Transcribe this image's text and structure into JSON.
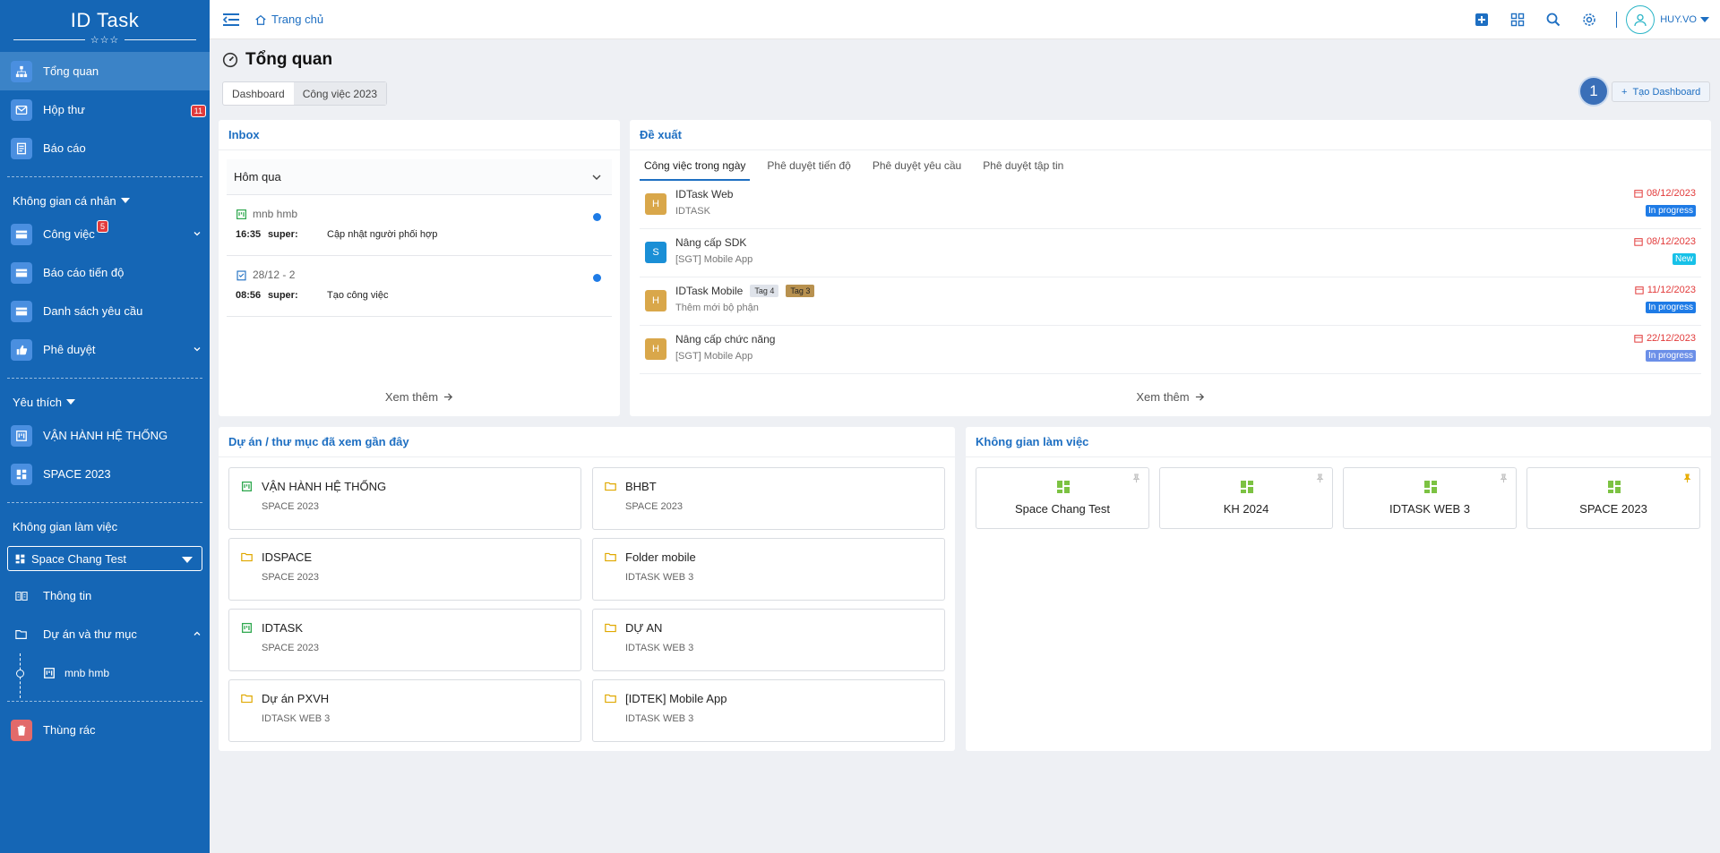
{
  "app": {
    "name": "ID Task",
    "stars": "☆☆☆"
  },
  "sidebar": {
    "main_items": [
      {
        "label": "Tổng quan"
      },
      {
        "label": "Hộp thư",
        "badge": "11"
      },
      {
        "label": "Báo cáo"
      }
    ],
    "personal_section": "Không gian cá nhân",
    "personal_items": [
      {
        "label": "Công việc",
        "badge": "5"
      },
      {
        "label": "Báo cáo tiến độ"
      },
      {
        "label": "Danh sách yêu cầu"
      },
      {
        "label": "Phê duyệt"
      }
    ],
    "favorites_section": "Yêu thích",
    "favorite_items": [
      {
        "label": "VẬN HÀNH HỆ THỐNG"
      },
      {
        "label": "SPACE 2023"
      }
    ],
    "workspace_section": "Không gian làm việc",
    "workspace_selected": "Space Chang Test",
    "workspace_items": [
      {
        "label": "Thông tin"
      },
      {
        "label": "Dự án và thư mục"
      }
    ],
    "tree_item": "mnb hmb",
    "trash": "Thùng rác"
  },
  "topbar": {
    "home": "Trang chủ",
    "username": "HUY.VO"
  },
  "page": {
    "title": "Tổng quan",
    "tabs": [
      "Dashboard",
      "Công việc 2023"
    ],
    "step": "1",
    "create_dashboard": "Tạo Dashboard"
  },
  "inbox": {
    "title": "Inbox",
    "group": "Hôm qua",
    "items": [
      {
        "source": "mnb hmb",
        "time": "16:35",
        "who": "super:",
        "action": "Cập nhật người phối hợp"
      },
      {
        "source": "28/12 - 2",
        "time": "08:56",
        "who": "super:",
        "action": "Tạo công việc"
      }
    ],
    "see_more": "Xem thêm"
  },
  "suggestions": {
    "title": "Đề xuất",
    "tabs": [
      "Công việc trong ngày",
      "Phê duyệt tiến độ",
      "Phê duyệt yêu cầu",
      "Phê duyệt tập tin"
    ],
    "items": [
      {
        "avatar": "H",
        "name": "IDTask Web",
        "sub": "IDTASK",
        "date": "08/12/2023",
        "status": "In progress"
      },
      {
        "avatar": "S",
        "name": "Nâng cấp SDK",
        "sub": "[SGT] Mobile App",
        "date": "08/12/2023",
        "status": "New"
      },
      {
        "avatar": "H",
        "name": "IDTask Mobile",
        "sub": "Thêm mới bộ phận",
        "date": "11/12/2023",
        "status": "In progress",
        "tags": [
          "Tag 4",
          "Tag 3"
        ]
      },
      {
        "avatar": "H",
        "name": "Nâng cấp chức năng",
        "sub": "[SGT] Mobile App",
        "date": "22/12/2023",
        "status": "In progress"
      }
    ],
    "see_more": "Xem thêm"
  },
  "recent": {
    "title": "Dự án / thư mục đã xem gần đây",
    "items": [
      {
        "name": "VẬN HÀNH HỆ THỐNG",
        "sub": "SPACE 2023",
        "icon": "board-icon"
      },
      {
        "name": "BHBT",
        "sub": "SPACE 2023",
        "icon": "folder-icon"
      },
      {
        "name": "IDSPACE",
        "sub": "SPACE 2023",
        "icon": "folder-icon"
      },
      {
        "name": "Folder mobile",
        "sub": "IDTASK WEB 3",
        "icon": "folder-icon"
      },
      {
        "name": "IDTASK",
        "sub": "SPACE 2023",
        "icon": "board-icon"
      },
      {
        "name": "DỰ AN",
        "sub": "IDTASK WEB 3",
        "icon": "folder-icon"
      },
      {
        "name": "Dự án PXVH",
        "sub": "IDTASK WEB 3",
        "icon": "folder-icon"
      },
      {
        "name": "[IDTEK] Mobile App",
        "sub": "IDTASK WEB 3",
        "icon": "folder-icon"
      }
    ]
  },
  "workspaces": {
    "title": "Không gian làm việc",
    "items": [
      {
        "name": "Space Chang Test",
        "pinned": false
      },
      {
        "name": "KH 2024",
        "pinned": false
      },
      {
        "name": "IDTASK WEB 3",
        "pinned": false
      },
      {
        "name": "SPACE 2023",
        "pinned": true
      }
    ]
  },
  "colors": {
    "sidebar": "#1566b5",
    "accent": "#1e6fc2",
    "in_progress": "#1e7be6",
    "new": "#17c1e8",
    "due_date": "#e23b3b",
    "tag3": "#b8914f",
    "tag4": "#dfe3ea"
  }
}
